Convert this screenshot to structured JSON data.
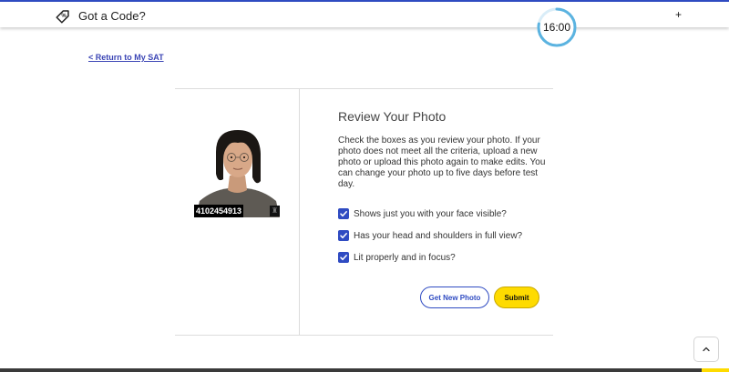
{
  "header": {
    "code_label": "Got a Code?",
    "code_icon": "tag-percent-icon",
    "timer_text": "16:00",
    "timer_progress": 0.78,
    "timer_color": "#5bb3e0",
    "plus_symbol": "+"
  },
  "nav": {
    "return_link": "< Return to My SAT"
  },
  "photo": {
    "id_number": "4102454913",
    "stamp_icon": "seal-icon",
    "stamp_glyph": "♜"
  },
  "review": {
    "title": "Review Your Photo",
    "instructions": "Check the boxes as you review your photo. If your photo does not meet all the criteria, upload a new photo or upload this photo again to make edits. You can change your photo up to five days before test day.",
    "checks": [
      {
        "label": "Shows just you with your face visible?",
        "checked": true
      },
      {
        "label": "Has your head and shoulders in full view?",
        "checked": true
      },
      {
        "label": "Lit properly and in focus?",
        "checked": true
      }
    ],
    "get_new_photo_label": "Get New Photo",
    "submit_label": "Submit"
  },
  "colors": {
    "accent_blue": "#2f4bc2",
    "submit_yellow": "#fedb00",
    "link_blue": "#3b45b5"
  },
  "scroll_top_icon": "chevron-up-icon"
}
